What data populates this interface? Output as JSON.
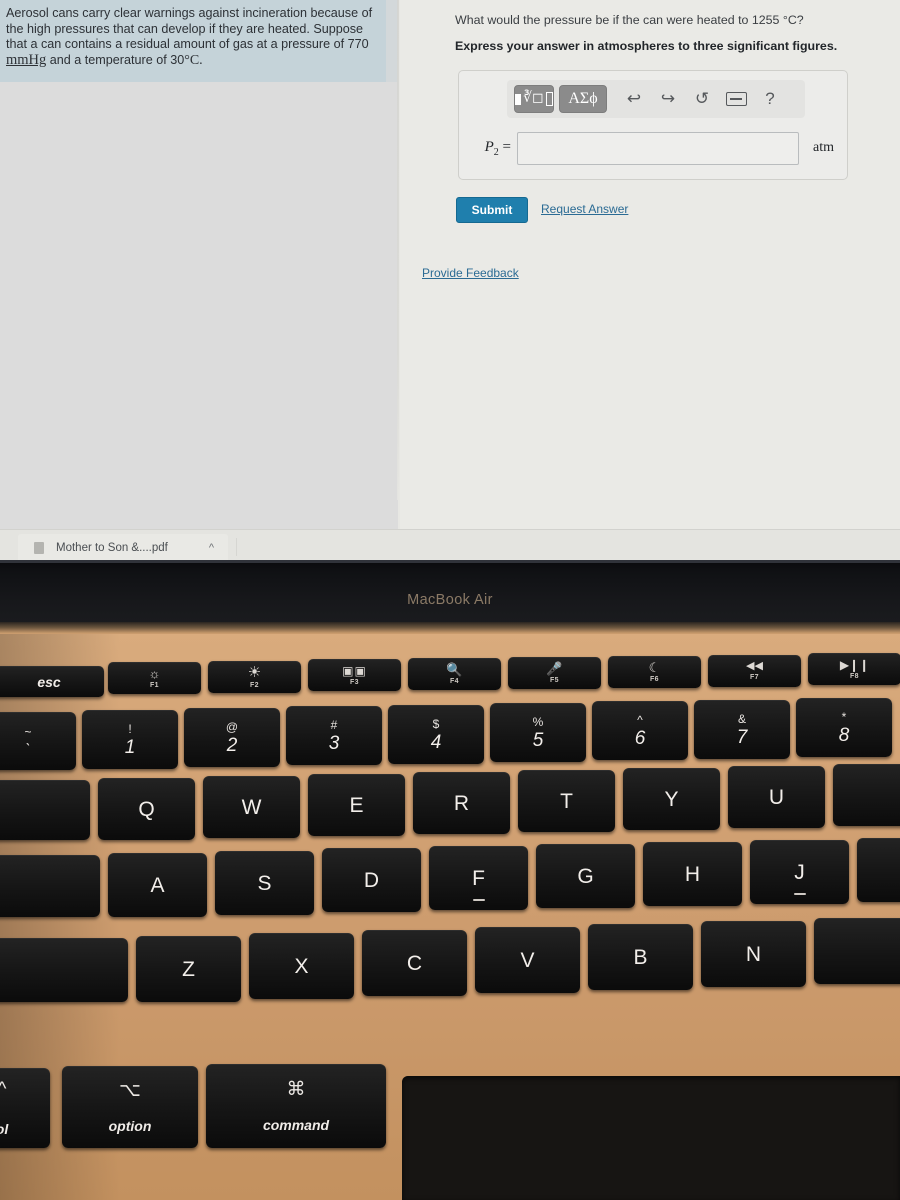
{
  "browser": {
    "download_bar": {
      "file_name": "Mother to Son &....pdf",
      "chevron": "^",
      "icon": "file-pdf-icon"
    }
  },
  "left_pane": {
    "question_card": {
      "line1": "Aerosol cans carry clear warnings against incineration because of",
      "line2": "the high pressures that can develop if they are heated. Suppose",
      "line3": "that a can contains a residual amount of gas at a pressure of 770",
      "line4_unit": "mmHg",
      "line4_rest": "and a temperature of 30",
      "line4_deg": "°C."
    }
  },
  "right_pane": {
    "question": "What would the pressure be if the can were heated to 1255 °C?",
    "instruction": "Express your answer in atmospheres to three significant figures.",
    "math_toolbar": {
      "template_button": "template-icon",
      "greek_button": "ΑΣϕ",
      "undo": "↩",
      "redo": "↪",
      "reset": "↺",
      "keyboard": "keyboard-icon",
      "help": "?"
    },
    "answer_row": {
      "variable_label": "P",
      "variable_sub": "2",
      "equals": "=",
      "value": "",
      "placeholder": "",
      "unit": "atm"
    },
    "submit_label": "Submit",
    "request_answer_label": "Request Answer",
    "provide_feedback_label": "Provide Feedback"
  },
  "laptop": {
    "brand_label": "MacBook Air",
    "function_row": [
      {
        "name": "esc",
        "glyph": "esc",
        "fkey": ""
      },
      {
        "name": "brightness-down",
        "glyph": "☼",
        "fkey": "F1"
      },
      {
        "name": "brightness-up",
        "glyph": "☀",
        "fkey": "F2"
      },
      {
        "name": "mission-control",
        "glyph": "☷",
        "fkey": "F3"
      },
      {
        "name": "spotlight-search",
        "glyph": "⌕",
        "fkey": "F4"
      },
      {
        "name": "dictation",
        "glyph": "⬛",
        "fkey": "F5"
      },
      {
        "name": "do-not-disturb",
        "glyph": "☾",
        "fkey": "F6"
      },
      {
        "name": "rewind",
        "glyph": "⏪",
        "fkey": "F7"
      },
      {
        "name": "play-pause",
        "glyph": "⏯",
        "fkey": "F8"
      }
    ],
    "number_row": [
      {
        "alt": "~",
        "main": "`"
      },
      {
        "alt": "!",
        "main": "1"
      },
      {
        "alt": "@",
        "main": "2"
      },
      {
        "alt": "#",
        "main": "3"
      },
      {
        "alt": "$",
        "main": "4"
      },
      {
        "alt": "%",
        "main": "5"
      },
      {
        "alt": "^",
        "main": "6"
      },
      {
        "alt": "&",
        "main": "7"
      },
      {
        "alt": "*",
        "main": "8"
      }
    ],
    "letter_row_1": [
      "Q",
      "W",
      "E",
      "R",
      "T",
      "Y",
      "U"
    ],
    "letter_row_2": [
      "A",
      "S",
      "D",
      "F",
      "G",
      "H",
      "J"
    ],
    "letter_row_3": [
      "Z",
      "X",
      "C",
      "V",
      "B",
      "N"
    ],
    "bottom_row": [
      {
        "label": "ol",
        "glyph": "^"
      },
      {
        "label": "option",
        "glyph": "⌥"
      },
      {
        "label": "command",
        "glyph": "⌘"
      }
    ]
  },
  "colors": {
    "accent_blue": "#1f7fad",
    "link_blue": "#2b6b94",
    "question_card_bg": "#c5d3d9",
    "deck_rose_gold": "#d3a375",
    "key_black": "#151515"
  }
}
